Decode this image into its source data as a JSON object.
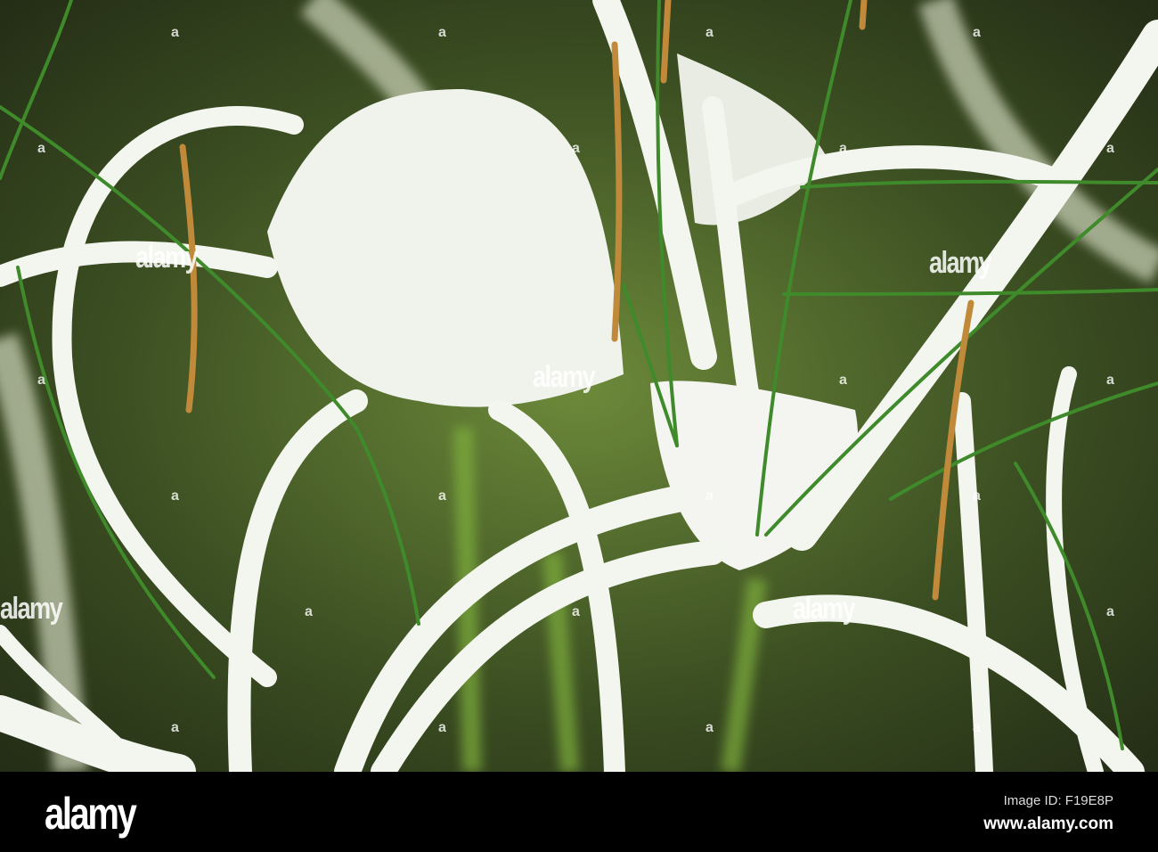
{
  "watermark": {
    "text": "alamy",
    "mark": "a"
  },
  "footer": {
    "logo": "alamy",
    "image_id": "Image ID: F19E8P",
    "url": "www.alamy.com"
  },
  "colors": {
    "background_green": "#3a4a22",
    "petal_white": "#f2f4ee",
    "stem_green": "#3f8a2a",
    "stamen_orange": "#c08a3a"
  }
}
